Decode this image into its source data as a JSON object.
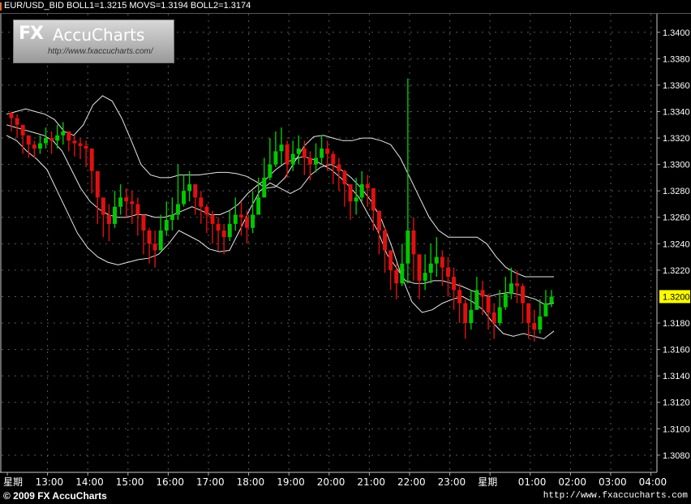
{
  "header": {
    "title": "EUR/USD_BID  BOLL1=1.3215  MOVS=1.3194  BOLL2=1.3174"
  },
  "logo": {
    "fx": "FX",
    "name": "AccuCharts",
    "url": "http://www.fxaccucharts.com/"
  },
  "footer": {
    "copyright": "© 2009 FX AccuCharts",
    "url": "http://www.fxaccucharts.com"
  },
  "colors": {
    "background": "#000000",
    "grid": "#5a5a5a",
    "up_candle": "#00c800",
    "down_candle": "#e01010",
    "bands": "#e8e8e8",
    "price_tag": "#ffff00"
  },
  "chart_data": {
    "type": "candlestick",
    "symbol": "EUR/USD_BID",
    "indicators": {
      "BOLL1": 1.3215,
      "MOVS": 1.3194,
      "BOLL2": 1.3174
    },
    "current_price": "1.3200",
    "y_ticks": [
      "1.3400",
      "1.3380",
      "1.3360",
      "1.3340",
      "1.3320",
      "1.3300",
      "1.3280",
      "1.3260",
      "1.3240",
      "1.3220",
      "1.3180",
      "1.3160",
      "1.3140",
      "1.3120",
      "1.3100",
      "1.3080"
    ],
    "ylim": [
      1.3067,
      1.3414
    ],
    "x_ticks": [
      "星期",
      "13:00",
      "14:00",
      "15:00",
      "16:00",
      "17:00",
      "18:00",
      "19:00",
      "20:00",
      "21:00",
      "22:00",
      "23:00",
      "星期",
      "01:00",
      "02:00",
      "03:00",
      "04:00"
    ],
    "grid": true,
    "close": [
      1.3335,
      1.333,
      1.3322,
      1.3315,
      1.3312,
      1.3316,
      1.332,
      1.3318,
      1.3322,
      1.3325,
      1.3318,
      1.3316,
      1.3314,
      1.3312,
      1.3295,
      1.3275,
      1.3262,
      1.3255,
      1.3268,
      1.3275,
      1.3272,
      1.327,
      1.3262,
      1.325,
      1.324,
      1.3235,
      1.325,
      1.3258,
      1.3262,
      1.327,
      1.328,
      1.3285,
      1.3275,
      1.3268,
      1.3262,
      1.3255,
      1.325,
      1.3245,
      1.3255,
      1.3262,
      1.326,
      1.3252,
      1.3262,
      1.3275,
      1.329,
      1.33,
      1.331,
      1.3315,
      1.33,
      1.3308,
      1.3312,
      1.3305,
      1.33,
      1.3305,
      1.3312,
      1.3308,
      1.33,
      1.3295,
      1.3285,
      1.3272,
      1.3275,
      1.3285,
      1.3282,
      1.3265,
      1.325,
      1.3235,
      1.322,
      1.321,
      1.3225,
      1.325,
      1.3232,
      1.3212,
      1.3218,
      1.3225,
      1.323,
      1.3222,
      1.3215,
      1.3205,
      1.3195,
      1.318,
      1.319,
      1.3205,
      1.32,
      1.3188,
      1.318,
      1.3192,
      1.3202,
      1.321,
      1.3208,
      1.3195,
      1.318,
      1.3175,
      1.3185,
      1.3195,
      1.32
    ],
    "high": [
      1.334,
      1.3338,
      1.3328,
      1.332,
      1.3318,
      1.3322,
      1.3328,
      1.3325,
      1.333,
      1.3332,
      1.3325,
      1.3322,
      1.332,
      1.3318,
      1.3312,
      1.3292,
      1.3272,
      1.327,
      1.328,
      1.3285,
      1.3282,
      1.328,
      1.3275,
      1.3262,
      1.3252,
      1.325,
      1.3262,
      1.3272,
      1.3275,
      1.33,
      1.3292,
      1.3295,
      1.3285,
      1.328,
      1.327,
      1.3265,
      1.326,
      1.3255,
      1.3265,
      1.3275,
      1.3272,
      1.3265,
      1.328,
      1.329,
      1.3305,
      1.332,
      1.3325,
      1.3328,
      1.3318,
      1.3318,
      1.3322,
      1.3318,
      1.331,
      1.3316,
      1.3322,
      1.3318,
      1.331,
      1.3305,
      1.3296,
      1.3285,
      1.329,
      1.3295,
      1.3292,
      1.3282,
      1.3265,
      1.3252,
      1.3235,
      1.3225,
      1.324,
      1.3365,
      1.326,
      1.323,
      1.3232,
      1.324,
      1.3245,
      1.3235,
      1.323,
      1.3222,
      1.321,
      1.3198,
      1.3205,
      1.3215,
      1.3212,
      1.3202,
      1.3195,
      1.3205,
      1.3215,
      1.3222,
      1.322,
      1.321,
      1.3195,
      1.319,
      1.3198,
      1.3205,
      1.3205
    ],
    "low": [
      1.3325,
      1.332,
      1.3308,
      1.3305,
      1.3305,
      1.3308,
      1.3312,
      1.3308,
      1.3312,
      1.3315,
      1.331,
      1.3306,
      1.3304,
      1.3298,
      1.3278,
      1.3255,
      1.3245,
      1.3242,
      1.3252,
      1.3262,
      1.326,
      1.3255,
      1.3246,
      1.3232,
      1.3225,
      1.3222,
      1.3236,
      1.3246,
      1.325,
      1.3258,
      1.3268,
      1.3272,
      1.3262,
      1.3255,
      1.3248,
      1.324,
      1.3235,
      1.3232,
      1.3242,
      1.325,
      1.3246,
      1.324,
      1.3248,
      1.3262,
      1.3275,
      1.3288,
      1.3298,
      1.33,
      1.329,
      1.3295,
      1.33,
      1.3292,
      1.3288,
      1.3294,
      1.33,
      1.3295,
      1.3285,
      1.328,
      1.3268,
      1.3258,
      1.3262,
      1.3272,
      1.3268,
      1.325,
      1.3232,
      1.3218,
      1.3205,
      1.3198,
      1.3208,
      1.321,
      1.3212,
      1.3198,
      1.3205,
      1.321,
      1.3215,
      1.3208,
      1.32,
      1.319,
      1.318,
      1.3168,
      1.3175,
      1.319,
      1.3186,
      1.3175,
      1.3168,
      1.3178,
      1.319,
      1.3198,
      1.3195,
      1.318,
      1.3168,
      1.3166,
      1.3172,
      1.3185,
      1.3192
    ],
    "upper_band": [
      1.3338,
      1.334,
      1.3342,
      1.334,
      1.3338,
      1.3334,
      1.3325,
      1.3322,
      1.333,
      1.3345,
      1.3352,
      1.3348,
      1.3335,
      1.3318,
      1.33,
      1.3292,
      1.329,
      1.329,
      1.3292,
      1.3292,
      1.3292,
      1.3293,
      1.3294,
      1.3294,
      1.3293,
      1.3291,
      1.3287,
      1.3282,
      1.3283,
      1.329,
      1.3302,
      1.3314,
      1.3321,
      1.3322,
      1.332,
      1.3318,
      1.3318,
      1.332,
      1.332,
      1.3318,
      1.3315,
      1.3305,
      1.329,
      1.3275,
      1.326,
      1.325,
      1.3245,
      1.3245,
      1.3245,
      1.3245,
      1.324,
      1.323,
      1.3222,
      1.3218,
      1.3215,
      1.3215,
      1.3215,
      1.3215
    ],
    "middle_band": [
      1.333,
      1.3328,
      1.3326,
      1.3324,
      1.3322,
      1.3318,
      1.331,
      1.3296,
      1.3282,
      1.3272,
      1.3266,
      1.3262,
      1.326,
      1.326,
      1.3262,
      1.3262,
      1.326,
      1.326,
      1.3262,
      1.3265,
      1.3268,
      1.3265,
      1.3262,
      1.3262,
      1.3265,
      1.327,
      1.3278,
      1.3284,
      1.3289,
      1.3296,
      1.3301,
      1.3304,
      1.3306,
      1.3304,
      1.33,
      1.3296,
      1.329,
      1.3283,
      1.3275,
      1.3262,
      1.325,
      1.3232,
      1.3222,
      1.3212,
      1.321,
      1.321,
      1.3212,
      1.3212,
      1.321,
      1.3208,
      1.3205,
      1.3202,
      1.32,
      1.3202,
      1.3203,
      1.3202,
      1.32,
      1.3198,
      1.3194,
      1.3195
    ],
    "lower_band": [
      1.3322,
      1.3318,
      1.331,
      1.3304,
      1.3296,
      1.328,
      1.3264,
      1.3248,
      1.3237,
      1.323,
      1.3226,
      1.3224,
      1.3226,
      1.3228,
      1.3229,
      1.3232,
      1.324,
      1.325,
      1.3246,
      1.3242,
      1.3236,
      1.3234,
      1.3235,
      1.325,
      1.3266,
      1.328,
      1.3286,
      1.3282,
      1.3278,
      1.3282,
      1.3292,
      1.3298,
      1.33,
      1.3296,
      1.329,
      1.3282,
      1.3272,
      1.3258,
      1.3238,
      1.3215,
      1.3196,
      1.3188,
      1.319,
      1.3195,
      1.3198,
      1.32,
      1.3196,
      1.319,
      1.318,
      1.3172,
      1.317,
      1.3172,
      1.317,
      1.3168,
      1.3174
    ]
  }
}
